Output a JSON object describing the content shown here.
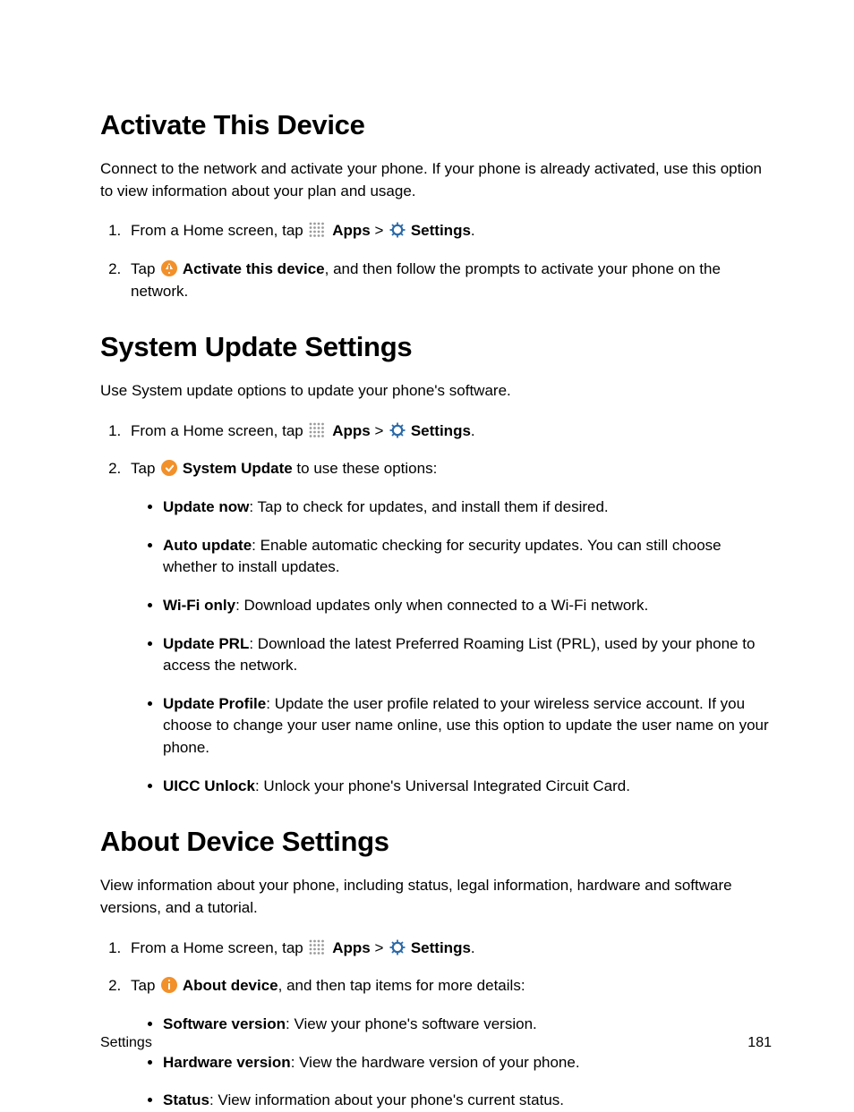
{
  "sections": [
    {
      "heading": "Activate This Device",
      "intro": "Connect to the network and activate your phone. If your phone is already activated, use this option to view information about your plan and usage.",
      "steps": [
        {
          "prefix": "From a Home screen, tap",
          "apps_label": "Apps",
          "sep": " > ",
          "settings_label": "Settings",
          "suffix": "."
        },
        {
          "tap_label": "Tap ",
          "bold_label": "Activate this device",
          "after": ", and then follow the prompts to activate your phone on the network."
        }
      ]
    },
    {
      "heading": "System Update Settings",
      "intro": "Use System update options to update your phone's software.",
      "steps": [
        {
          "prefix": "From a Home screen, tap",
          "apps_label": "Apps",
          "sep": " > ",
          "settings_label": "Settings",
          "suffix": "."
        },
        {
          "tap_label": "Tap ",
          "bold_label": "System Update",
          "after": " to use these options:",
          "bullets": [
            {
              "bold": "Update now",
              "text": ": Tap to check for updates, and install them if desired."
            },
            {
              "bold": "Auto update",
              "text": ": Enable automatic checking for security updates. You can still choose whether to install updates."
            },
            {
              "bold": "Wi-Fi only",
              "text": ": Download updates only when connected to a Wi-Fi network."
            },
            {
              "bold": "Update PRL",
              "text": ": Download the latest Preferred Roaming List (PRL), used by your phone to access the network."
            },
            {
              "bold": "Update Profile",
              "text": ": Update the user profile related to your wireless service account. If you choose to change your user name online, use this option to update the user name on your phone."
            },
            {
              "bold": "UICC Unlock",
              "text": ": Unlock your phone's Universal Integrated Circuit Card."
            }
          ]
        }
      ]
    },
    {
      "heading": "About Device Settings",
      "intro": "View information about your phone, including status, legal information, hardware and software versions, and a tutorial.",
      "steps": [
        {
          "prefix": "From a Home screen, tap",
          "apps_label": "Apps",
          "sep": " > ",
          "settings_label": "Settings",
          "suffix": "."
        },
        {
          "tap_label": "Tap ",
          "bold_label": "About device",
          "after": ", and then tap items for more details:",
          "bullets": [
            {
              "bold": "Software version",
              "text": ": View your phone's software version."
            },
            {
              "bold": "Hardware version",
              "text": ": View the hardware version of your phone."
            },
            {
              "bold": "Status",
              "text": ": View information about your phone's current status."
            }
          ]
        }
      ]
    }
  ],
  "footer": {
    "left": "Settings",
    "right": "181"
  }
}
